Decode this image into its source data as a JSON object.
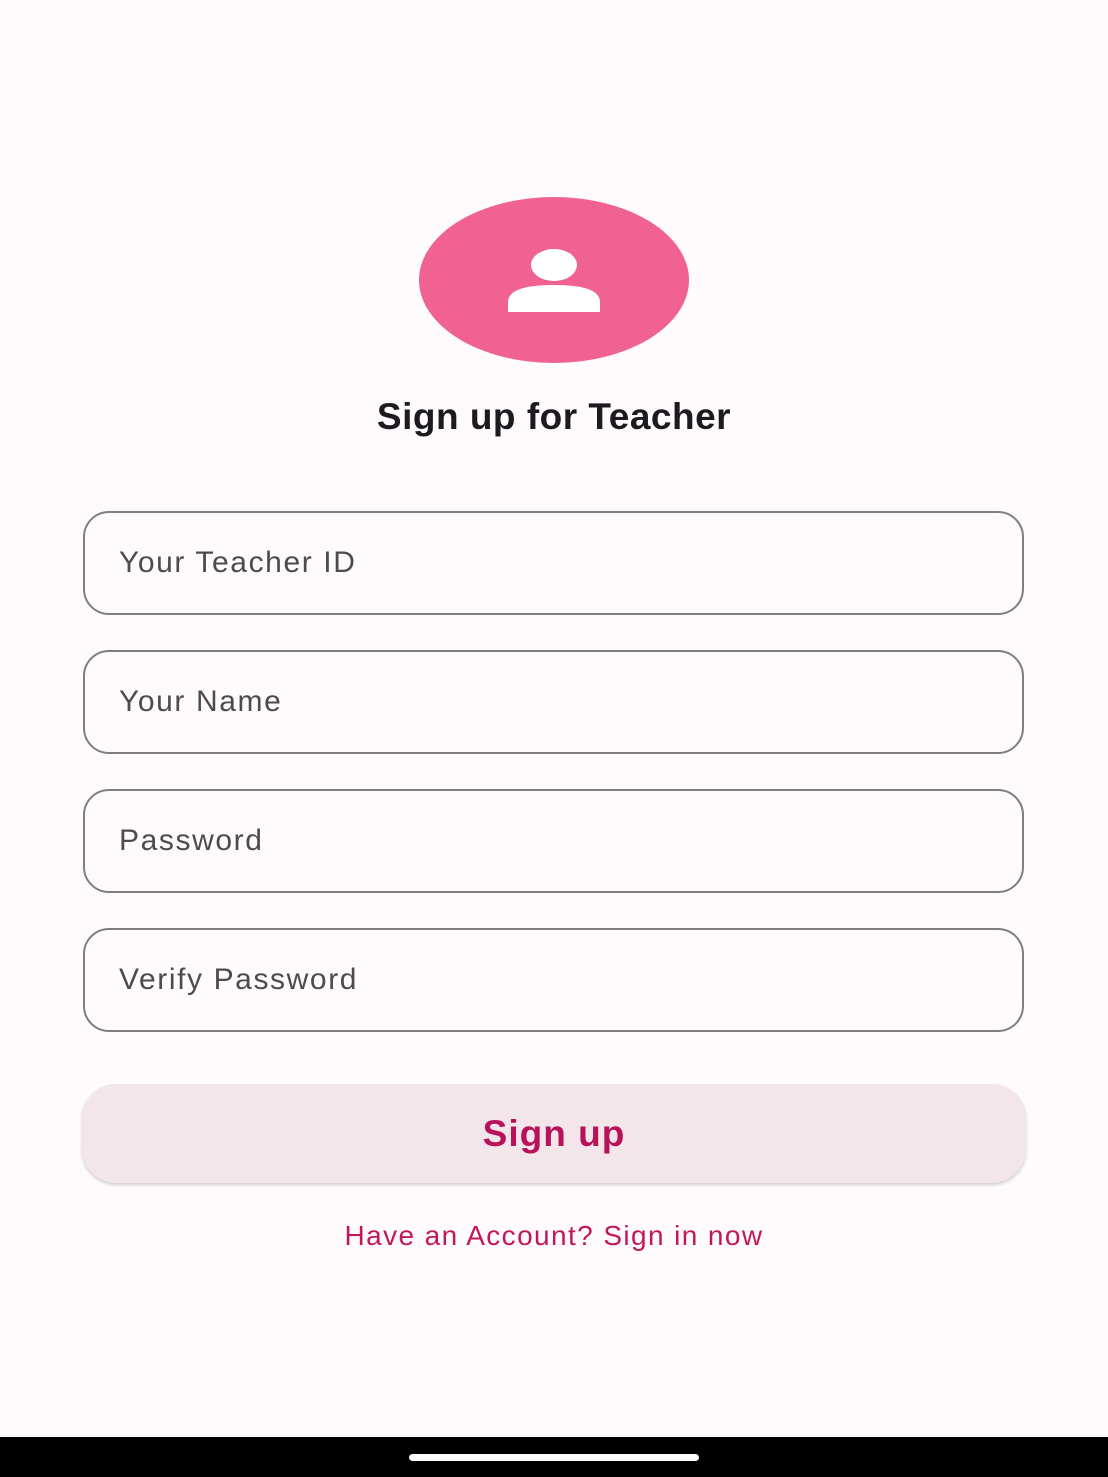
{
  "header": {
    "title": "Sign up for Teacher"
  },
  "avatar": {
    "icon": "person-icon",
    "color": "#f06292"
  },
  "form": {
    "fields": [
      {
        "placeholder": "Your Teacher ID"
      },
      {
        "placeholder": "Your Name"
      },
      {
        "placeholder": "Password"
      },
      {
        "placeholder": "Verify Password"
      }
    ],
    "submit_label": "Sign up",
    "signin_link": "Have an Account? Sign in now"
  },
  "colors": {
    "accent": "#c2185b",
    "background": "#fffbfd",
    "button_bg": "#f2e6ea",
    "field_border": "#857c82"
  }
}
